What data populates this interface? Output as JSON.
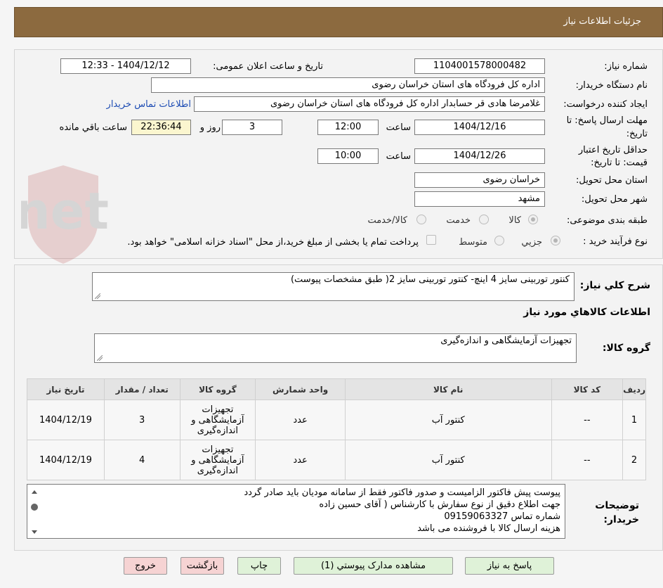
{
  "header": {
    "title": "جزئیات اطلاعات نیاز"
  },
  "watermark": {
    "text": "AriaTender.net"
  },
  "fields": {
    "need_number_label": "شماره نیاز:",
    "need_number": "1104001578000482",
    "announce_label": "تاریخ و ساعت اعلان عمومی:",
    "announce_value": "1404/12/12 - 12:33",
    "buyer_org_label": "نام دستگاه خریدار:",
    "buyer_org": "اداره کل فرودگاه های استان خراسان رضوی",
    "requester_label": "ایجاد کننده درخواست:",
    "requester": "غلامرضا هادی قر حسابدار اداره کل فرودگاه های استان خراسان رضوی",
    "contact_link": "اطلاعات تماس خریدار",
    "deadline_label_1": "مهلت ارسال پاسخ: تا",
    "deadline_label_2": "تاریخ:",
    "deadline_date": "1404/12/16",
    "time_label": "ساعت",
    "deadline_time": "12:00",
    "days_value": "3",
    "days_label": "روز و",
    "remaining_time": "22:36:44",
    "remaining_label": "ساعت باقي مانده",
    "validity_label_1": "حداقل تاریخ اعتبار",
    "validity_label_2": "قیمت: تا تاریخ:",
    "validity_date": "1404/12/26",
    "validity_time": "10:00",
    "province_label": "استان محل تحویل:",
    "province": "خراسان رضوی",
    "city_label": "شهر محل تحویل:",
    "city": "مشهد",
    "category_label": "طبقه بندی موضوعی:",
    "category_options": [
      "کالا",
      "خدمت",
      "کالا/خدمت"
    ],
    "purchase_type_label": "نوع فرآیند خرید :",
    "purchase_options": [
      "جزیي",
      "متوسط"
    ],
    "purchase_note": "پرداخت تمام یا بخشی از مبلغ خرید،از محل \"اسناد خزانه اسلامی\" خواهد بود."
  },
  "summary": {
    "label": "شرح کلي نیاز:",
    "text": "کنتور توربینی سایز 4 اینچ- کنتور توربینی سایز 2( طبق مشخصات پیوست)"
  },
  "goods_info": {
    "title": "اطلاعات کالاهاي مورد نیاز",
    "group_label": "گروه کالا:",
    "group_value": "تجهیزات آزمایشگاهی و اندازه‌گیری"
  },
  "table": {
    "headers": [
      "ردیف",
      "کد کالا",
      "نام کالا",
      "واحد شمارش",
      "گروه کالا",
      "تعداد / مقدار",
      "تاریخ نیاز"
    ],
    "rows": [
      [
        "1",
        "--",
        "کنتور آب",
        "عدد",
        "تجهیزات آزمایشگاهی و اندازه‌گیری",
        "3",
        "1404/12/19"
      ],
      [
        "2",
        "--",
        "کنتور آب",
        "عدد",
        "تجهیزات آزمایشگاهی و اندازه‌گیری",
        "4",
        "1404/12/19"
      ]
    ]
  },
  "notes": {
    "label_1": "توضیحات",
    "label_2": "خریدار:",
    "lines": [
      "پیوست پیش فاکتور الزامیست و صدور فاکتور فقط از سامانه مودیان باید صادر گردد",
      "جهت اطلاع دقیق از نوع سفارش با کارشناس  ( آقای  حسین زاده",
      "شماره تماس  09159063327",
      "هزینه ارسال کالا با فروشنده می باشد"
    ]
  },
  "buttons": {
    "reply": "پاسخ به نیاز",
    "attachments": "مشاهده مدارک پیوستي (1)",
    "print": "چاپ",
    "back": "بازگشت",
    "exit": "خروج"
  }
}
